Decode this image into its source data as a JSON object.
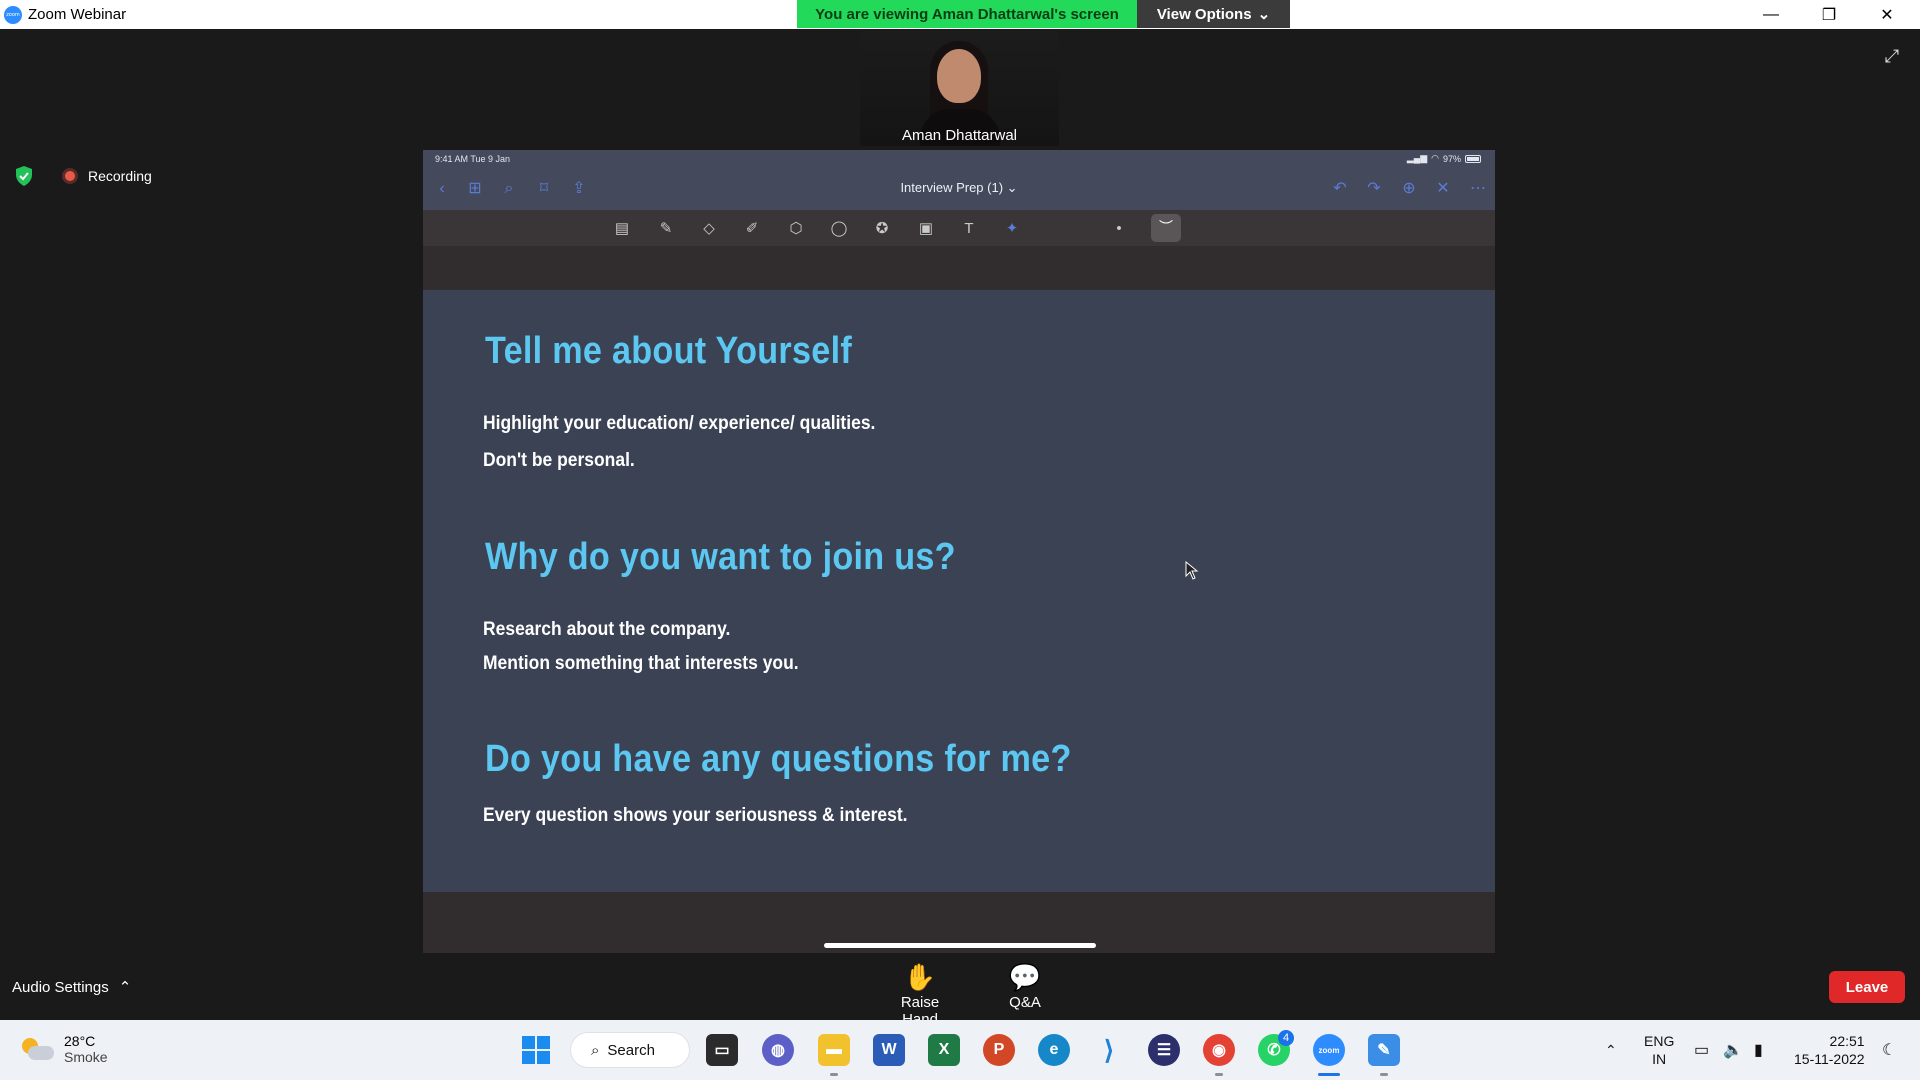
{
  "window": {
    "title": "Zoom Webinar",
    "banner": "You are viewing Aman Dhattarwal's screen",
    "view_options": "View Options",
    "minimize": "—",
    "restore": "❐",
    "close": "✕"
  },
  "video": {
    "name": "Aman Dhattarwal"
  },
  "recording": {
    "label": "Recording"
  },
  "ipad": {
    "time": "9:41 AM  Tue 9 Jan",
    "battery": "97%",
    "doc_title": "Interview Prep (1)"
  },
  "slide": {
    "h1": "Tell me about Yourself",
    "l1a": "Highlight your education/ experience/ qualities.",
    "l1b": "Don't be personal.",
    "h2": "Why do you want to join us?",
    "l2a": "Research about the company.",
    "l2b": "Mention something that interests you.",
    "h3": "Do you have any questions for me?",
    "l3a": "Every question shows your seriousness & interest."
  },
  "controls": {
    "audio_settings": "Audio Settings",
    "raise_hand": "Raise Hand",
    "qa": "Q&A",
    "leave": "Leave"
  },
  "taskbar": {
    "temp": "28°C",
    "condition": "Smoke",
    "search": "Search",
    "whatsapp_badge": "4",
    "lang1": "ENG",
    "lang2": "IN",
    "time": "22:51",
    "date": "15-11-2022"
  },
  "colors": {
    "banner_green": "#23d959",
    "heading_blue": "#5cc7f0",
    "leave_red": "#e02828"
  }
}
